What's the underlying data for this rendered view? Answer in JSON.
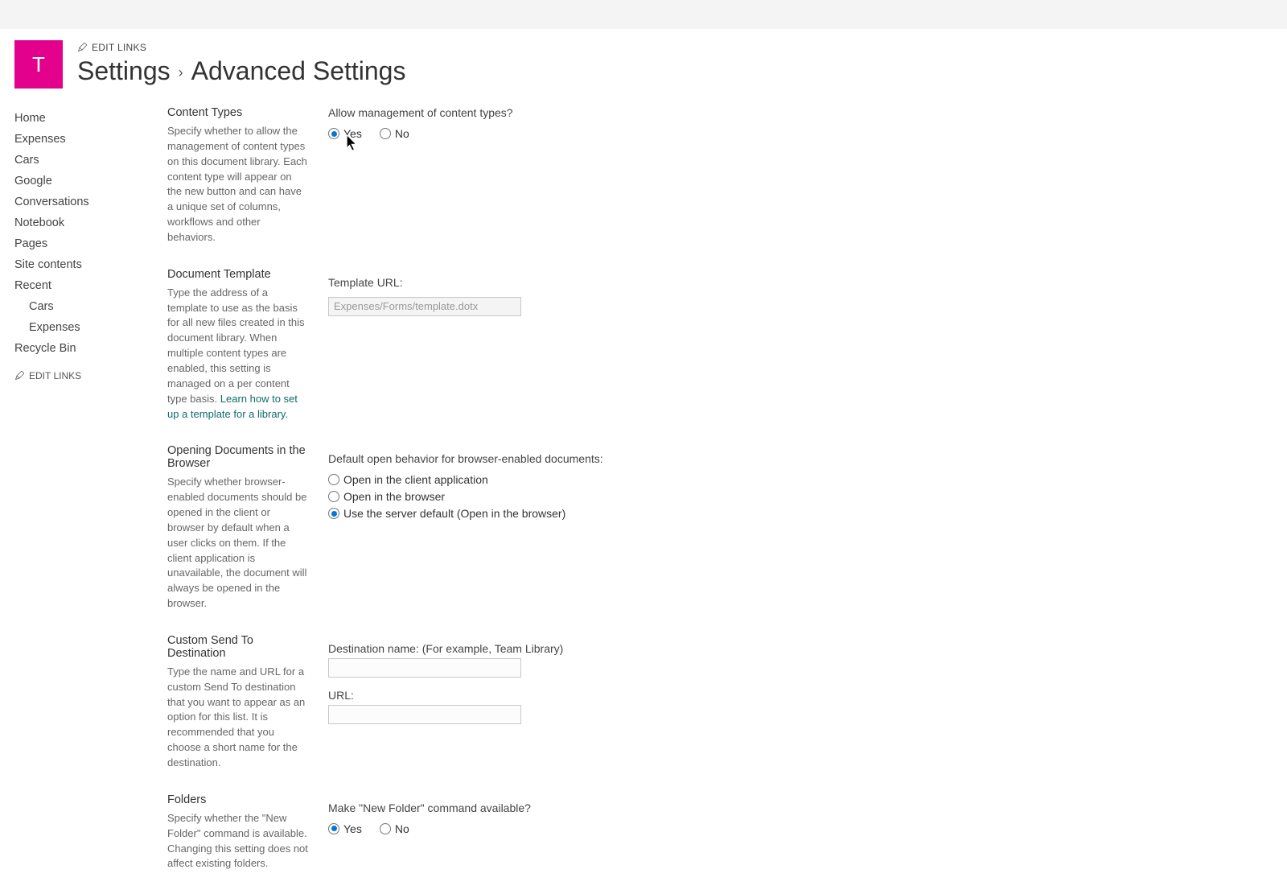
{
  "siteTile": "T",
  "editLinksLabel": "EDIT LINKS",
  "breadcrumb": {
    "settings": "Settings",
    "sep": "›",
    "current": "Advanced Settings"
  },
  "nav": {
    "items": [
      "Home",
      "Expenses",
      "Cars",
      "Google",
      "Conversations",
      "Notebook",
      "Pages",
      "Site contents"
    ],
    "recentLabel": "Recent",
    "recent": [
      "Cars",
      "Expenses"
    ],
    "recycle": "Recycle Bin",
    "editLinks": "EDIT LINKS"
  },
  "sections": {
    "contentTypes": {
      "title": "Content Types",
      "desc": "Specify whether to allow the management of content types on this document library. Each content type will appear on the new button and can have a unique set of columns, workflows and other behaviors.",
      "question": "Allow management of content types?",
      "yes": "Yes",
      "no": "No",
      "selected": "yes"
    },
    "template": {
      "title": "Document Template",
      "desc": "Type the address of a template to use as the basis for all new files created in this document library. When multiple content types are enabled, this setting is managed on a per content type basis. ",
      "link": "Learn how to set up a template for a library.",
      "label": "Template URL:",
      "value": "Expenses/Forms/template.dotx"
    },
    "opening": {
      "title": "Opening Documents in the Browser",
      "desc": "Specify whether browser-enabled documents should be opened in the client or browser by default when a user clicks on them. If the client application is unavailable, the document will always be opened in the browser.",
      "label": "Default open behavior for browser-enabled documents:",
      "opts": [
        "Open in the client application",
        "Open in the browser",
        "Use the server default (Open in the browser)"
      ],
      "selected": 2
    },
    "sendto": {
      "title": "Custom Send To Destination",
      "desc": "Type the name and URL for a custom Send To destination that you want to appear as an option for this list. It is recommended that you choose a short name for the destination.",
      "destLabel": "Destination name: (For example, Team Library)",
      "urlLabel": "URL:"
    },
    "folders": {
      "title": "Folders",
      "desc": "Specify whether the \"New Folder\" command is available. Changing this setting does not affect existing folders.",
      "question": "Make \"New Folder\" command available?",
      "yes": "Yes",
      "no": "No",
      "selected": "yes"
    }
  }
}
